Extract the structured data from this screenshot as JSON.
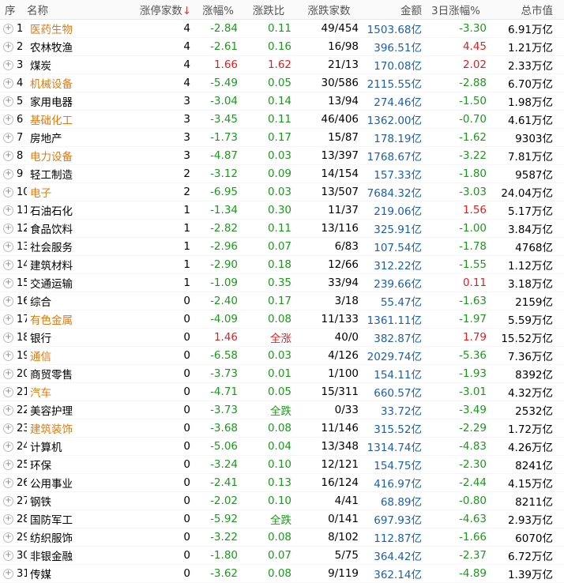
{
  "headers": {
    "seq": "序",
    "name": "名称",
    "limit_up": "涨停家数",
    "limit_up_sort": "↓",
    "pct": "涨幅%",
    "ratio": "涨跌比",
    "updown": "涨跌家数",
    "amount": "金额",
    "pct3d": "3日涨幅%",
    "mktcap": "总市值"
  },
  "rows": [
    {
      "no": "1",
      "name": "医药生物",
      "hl": true,
      "lim": "4",
      "pct": "-2.84",
      "ratio": "0.11",
      "ud": "49/454",
      "amt": "1503.68亿",
      "p3": "-3.30",
      "cap": "6.91万亿"
    },
    {
      "no": "2",
      "name": "农林牧渔",
      "hl": false,
      "lim": "4",
      "pct": "-2.61",
      "ratio": "0.16",
      "ud": "16/98",
      "amt": "396.51亿",
      "p3": "4.45",
      "cap": "1.21万亿"
    },
    {
      "no": "3",
      "name": "煤炭",
      "hl": false,
      "lim": "4",
      "pct": "1.66",
      "ratio": "1.62",
      "ud": "21/13",
      "amt": "170.08亿",
      "p3": "2.02",
      "cap": "2.33万亿"
    },
    {
      "no": "4",
      "name": "机械设备",
      "hl": true,
      "lim": "4",
      "pct": "-5.49",
      "ratio": "0.05",
      "ud": "30/586",
      "amt": "2115.55亿",
      "p3": "-2.88",
      "cap": "6.70万亿"
    },
    {
      "no": "5",
      "name": "家用电器",
      "hl": false,
      "lim": "3",
      "pct": "-3.04",
      "ratio": "0.14",
      "ud": "13/94",
      "amt": "274.46亿",
      "p3": "-1.50",
      "cap": "1.98万亿"
    },
    {
      "no": "6",
      "name": "基础化工",
      "hl": true,
      "lim": "3",
      "pct": "-3.45",
      "ratio": "0.11",
      "ud": "46/406",
      "amt": "1362.00亿",
      "p3": "-0.70",
      "cap": "4.61万亿"
    },
    {
      "no": "7",
      "name": "房地产",
      "hl": false,
      "lim": "3",
      "pct": "-1.73",
      "ratio": "0.17",
      "ud": "15/87",
      "amt": "178.19亿",
      "p3": "-1.62",
      "cap": "9303亿"
    },
    {
      "no": "8",
      "name": "电力设备",
      "hl": true,
      "lim": "3",
      "pct": "-4.87",
      "ratio": "0.03",
      "ud": "13/397",
      "amt": "1768.67亿",
      "p3": "-3.22",
      "cap": "7.81万亿"
    },
    {
      "no": "9",
      "name": "轻工制造",
      "hl": false,
      "lim": "2",
      "pct": "-3.12",
      "ratio": "0.09",
      "ud": "14/154",
      "amt": "157.33亿",
      "p3": "-1.80",
      "cap": "9587亿"
    },
    {
      "no": "10",
      "name": "电子",
      "hl": true,
      "lim": "2",
      "pct": "-6.95",
      "ratio": "0.03",
      "ud": "13/507",
      "amt": "7684.32亿",
      "p3": "-3.03",
      "cap": "24.04万亿"
    },
    {
      "no": "11",
      "name": "石油石化",
      "hl": false,
      "lim": "1",
      "pct": "-1.34",
      "ratio": "0.30",
      "ud": "11/37",
      "amt": "219.06亿",
      "p3": "1.56",
      "cap": "5.17万亿"
    },
    {
      "no": "12",
      "name": "食品饮料",
      "hl": false,
      "lim": "1",
      "pct": "-2.82",
      "ratio": "0.11",
      "ud": "13/116",
      "amt": "325.91亿",
      "p3": "-1.00",
      "cap": "3.84万亿"
    },
    {
      "no": "13",
      "name": "社会服务",
      "hl": false,
      "lim": "1",
      "pct": "-2.96",
      "ratio": "0.07",
      "ud": "6/83",
      "amt": "107.54亿",
      "p3": "-1.78",
      "cap": "4768亿"
    },
    {
      "no": "14",
      "name": "建筑材料",
      "hl": false,
      "lim": "1",
      "pct": "-2.90",
      "ratio": "0.18",
      "ud": "12/66",
      "amt": "312.22亿",
      "p3": "-1.55",
      "cap": "1.12万亿"
    },
    {
      "no": "15",
      "name": "交通运输",
      "hl": false,
      "lim": "1",
      "pct": "-1.09",
      "ratio": "0.35",
      "ud": "33/94",
      "amt": "239.66亿",
      "p3": "0.11",
      "cap": "3.18万亿"
    },
    {
      "no": "16",
      "name": "综合",
      "hl": false,
      "lim": "0",
      "pct": "-2.40",
      "ratio": "0.17",
      "ud": "3/18",
      "amt": "55.47亿",
      "p3": "-1.63",
      "cap": "2159亿"
    },
    {
      "no": "17",
      "name": "有色金属",
      "hl": true,
      "lim": "0",
      "pct": "-4.09",
      "ratio": "0.08",
      "ud": "11/133",
      "amt": "1361.11亿",
      "p3": "-1.97",
      "cap": "5.59万亿"
    },
    {
      "no": "18",
      "name": "银行",
      "hl": false,
      "lim": "0",
      "pct": "1.46",
      "ratio": "全涨",
      "ud": "40/0",
      "amt": "382.87亿",
      "p3": "1.79",
      "cap": "15.52万亿"
    },
    {
      "no": "19",
      "name": "通信",
      "hl": true,
      "lim": "0",
      "pct": "-6.58",
      "ratio": "0.03",
      "ud": "4/126",
      "amt": "2029.74亿",
      "p3": "-5.36",
      "cap": "7.36万亿"
    },
    {
      "no": "20",
      "name": "商贸零售",
      "hl": false,
      "lim": "0",
      "pct": "-3.73",
      "ratio": "0.01",
      "ud": "1/100",
      "amt": "154.11亿",
      "p3": "-1.93",
      "cap": "8392亿"
    },
    {
      "no": "21",
      "name": "汽车",
      "hl": true,
      "lim": "0",
      "pct": "-4.71",
      "ratio": "0.05",
      "ud": "15/311",
      "amt": "660.57亿",
      "p3": "-3.01",
      "cap": "4.32万亿"
    },
    {
      "no": "22",
      "name": "美容护理",
      "hl": false,
      "lim": "0",
      "pct": "-3.73",
      "ratio": "全跌",
      "ud": "0/33",
      "amt": "33.72亿",
      "p3": "-3.49",
      "cap": "2532亿"
    },
    {
      "no": "23",
      "name": "建筑装饰",
      "hl": true,
      "lim": "0",
      "pct": "-3.68",
      "ratio": "0.08",
      "ud": "11/146",
      "amt": "315.52亿",
      "p3": "-2.29",
      "cap": "1.72万亿"
    },
    {
      "no": "24",
      "name": "计算机",
      "hl": false,
      "lim": "0",
      "pct": "-5.06",
      "ratio": "0.04",
      "ud": "13/348",
      "amt": "1314.74亿",
      "p3": "-4.83",
      "cap": "4.26万亿"
    },
    {
      "no": "25",
      "name": "环保",
      "hl": false,
      "lim": "0",
      "pct": "-3.24",
      "ratio": "0.10",
      "ud": "12/121",
      "amt": "154.75亿",
      "p3": "-2.30",
      "cap": "8241亿"
    },
    {
      "no": "26",
      "name": "公用事业",
      "hl": false,
      "lim": "0",
      "pct": "-2.41",
      "ratio": "0.13",
      "ud": "16/124",
      "amt": "416.97亿",
      "p3": "-2.44",
      "cap": "4.15万亿"
    },
    {
      "no": "27",
      "name": "钢铁",
      "hl": false,
      "lim": "0",
      "pct": "-2.02",
      "ratio": "0.10",
      "ud": "4/41",
      "amt": "68.89亿",
      "p3": "-0.80",
      "cap": "8211亿"
    },
    {
      "no": "28",
      "name": "国防军工",
      "hl": false,
      "lim": "0",
      "pct": "-5.92",
      "ratio": "全跌",
      "ud": "0/141",
      "amt": "697.93亿",
      "p3": "-4.63",
      "cap": "2.93万亿"
    },
    {
      "no": "29",
      "name": "纺织服饰",
      "hl": false,
      "lim": "0",
      "pct": "-3.22",
      "ratio": "0.08",
      "ud": "8/102",
      "amt": "112.87亿",
      "p3": "-1.66",
      "cap": "6070亿"
    },
    {
      "no": "30",
      "name": "非银金融",
      "hl": false,
      "lim": "0",
      "pct": "-1.80",
      "ratio": "0.07",
      "ud": "5/75",
      "amt": "364.42亿",
      "p3": "-2.37",
      "cap": "6.72万亿"
    },
    {
      "no": "31",
      "name": "传媒",
      "hl": false,
      "lim": "0",
      "pct": "-3.62",
      "ratio": "0.08",
      "ud": "9/119",
      "amt": "362.14亿",
      "p3": "-4.89",
      "cap": "1.39万亿"
    }
  ],
  "colors": {
    "up": "#e02020",
    "down": "#1a9a1a",
    "amount": "#1a5fb4",
    "highlight_name": "#e07a10"
  },
  "icons": {
    "expand": "plus-circle-icon"
  }
}
